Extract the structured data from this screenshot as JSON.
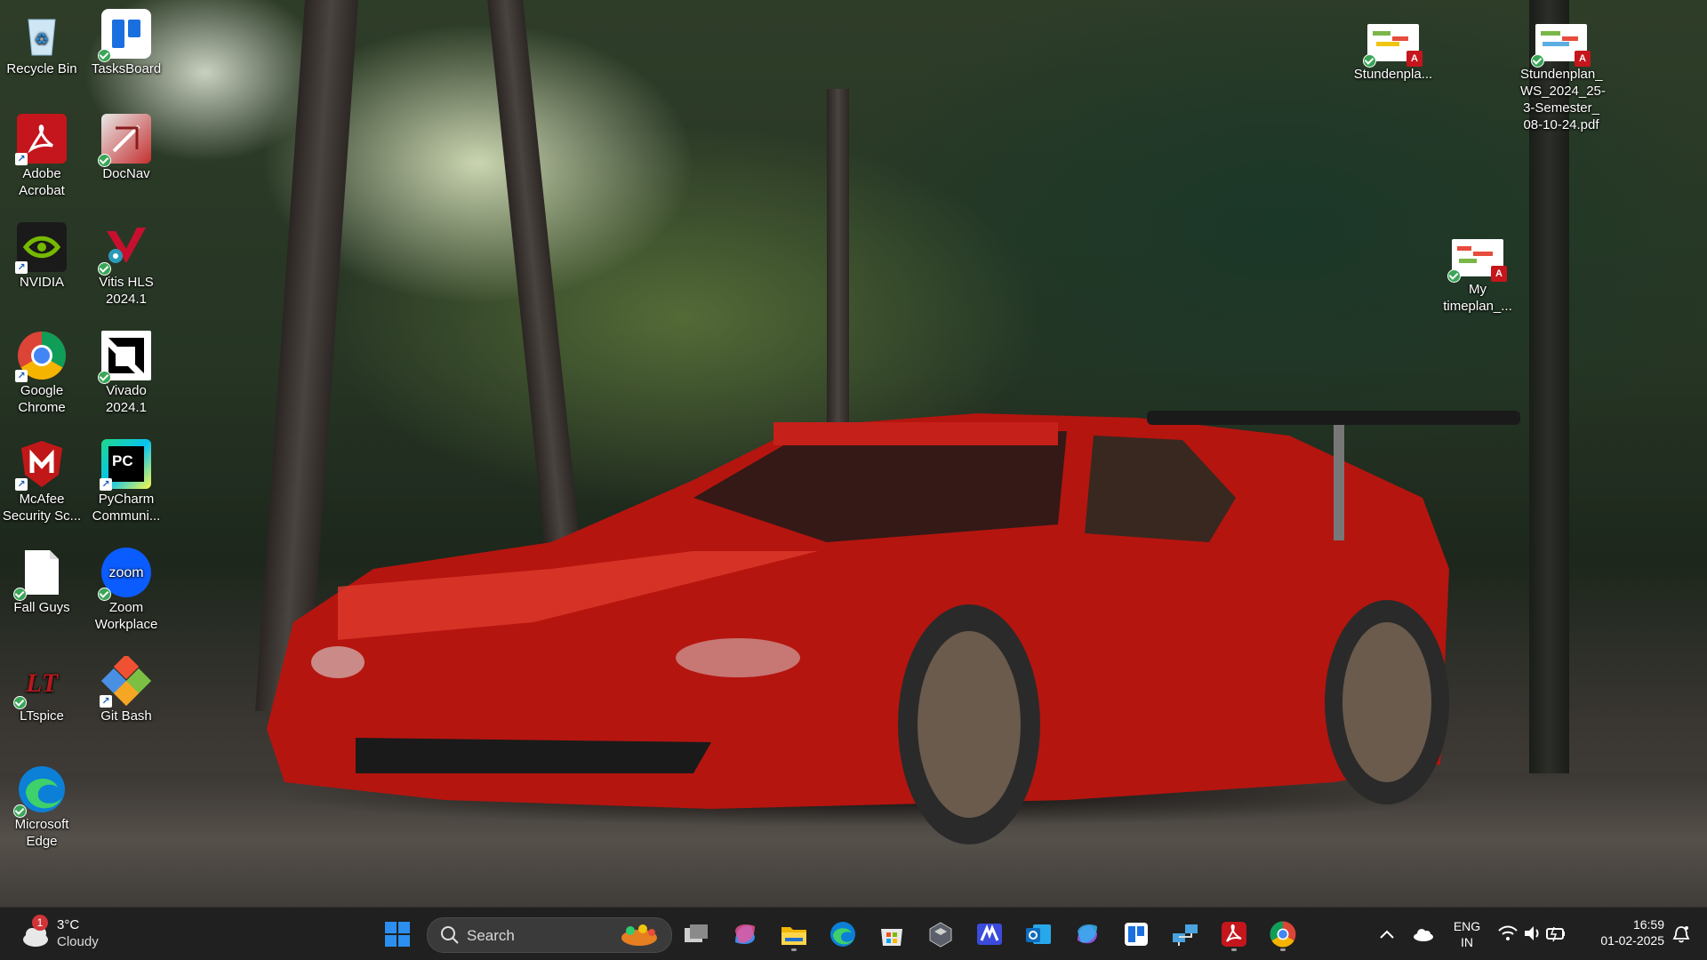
{
  "desktop": {
    "icons_left_col": [
      {
        "name": "recycle-bin",
        "label": "Recycle Bin"
      },
      {
        "name": "adobe-acrobat",
        "label": "Adobe Acrobat"
      },
      {
        "name": "nvidia",
        "label": "NVIDIA"
      },
      {
        "name": "google-chrome",
        "label": "Google Chrome"
      },
      {
        "name": "mcafee",
        "label": "McAfee Security Sc..."
      },
      {
        "name": "fall-guys",
        "label": "Fall Guys"
      },
      {
        "name": "ltspice",
        "label": "LTspice"
      },
      {
        "name": "microsoft-edge",
        "label": "Microsoft Edge"
      }
    ],
    "icons_right_col": [
      {
        "name": "tasksboard",
        "label": "TasksBoard"
      },
      {
        "name": "docnav",
        "label": "DocNav"
      },
      {
        "name": "vitis-hls",
        "label": "Vitis HLS 2024.1"
      },
      {
        "name": "vivado",
        "label": "Vivado 2024.1"
      },
      {
        "name": "pycharm",
        "label": "PyCharm Communi..."
      },
      {
        "name": "zoom",
        "label": "Zoom Workplace"
      },
      {
        "name": "git-bash",
        "label": "Git Bash"
      }
    ],
    "files": [
      {
        "name": "stundenplan-short",
        "label": "Stundenpla..."
      },
      {
        "name": "stundenplan-full",
        "label": "Stundenplan_ WS_2024_25- 3-Semester_ 08-10-24.pdf"
      },
      {
        "name": "my-timeplan",
        "label": "My timeplan_..."
      }
    ],
    "icon_glyphs": {
      "pycharm": "PC",
      "zoom": "zoom"
    }
  },
  "taskbar": {
    "weather": {
      "badge": "1",
      "temp": "3°C",
      "condition": "Cloudy"
    },
    "search_placeholder": "Search",
    "pinned": [
      "task-view",
      "copilot",
      "file-explorer",
      "edge",
      "store",
      "app-hexagon",
      "visual-studio-code-like",
      "outlook",
      "m365",
      "tasksboard",
      "remote-desktop",
      "acrobat",
      "chrome"
    ],
    "tray": {
      "lang_top": "ENG",
      "lang_bottom": "IN",
      "time": "16:59",
      "date": "01-02-2025"
    }
  }
}
